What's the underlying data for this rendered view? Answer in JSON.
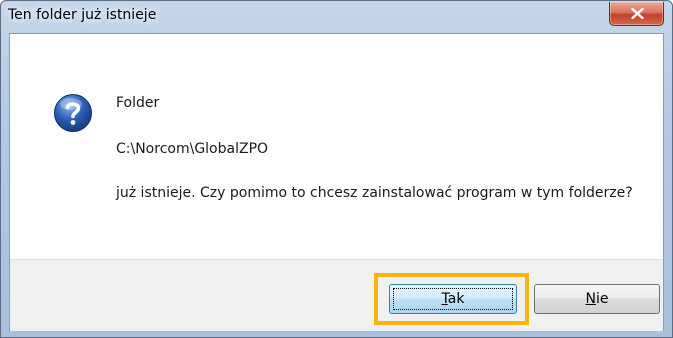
{
  "window": {
    "title": "Ten folder już istnieje",
    "close_glyph": "x"
  },
  "message": {
    "line1": "Folder",
    "path": "C:\\Norcom\\GlobalZPO",
    "line2": "już istnieje. Czy pomimo to chcesz zainstalować program w tym folderze?"
  },
  "icons": {
    "question": "question-icon",
    "close": "close-icon"
  },
  "buttons": {
    "yes_label_underlined": "T",
    "yes_label_rest": "ak",
    "no_label_underlined": "N",
    "no_label_rest": "ie"
  },
  "colors": {
    "highlight": "#f5b50f",
    "question_icon_blue": "#2b5fb3"
  }
}
